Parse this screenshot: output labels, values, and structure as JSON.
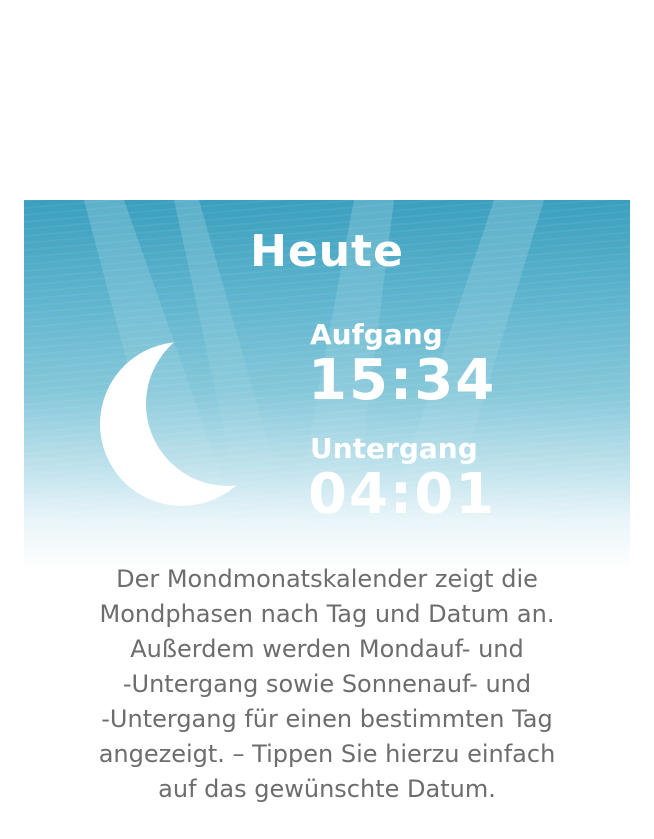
{
  "colors": {
    "sky_top": "#3a9fbe",
    "sky_bottom": "#ffffff",
    "foreground": "#ffffff",
    "description_text": "#6d6d6d"
  },
  "moon_card": {
    "title": "Heute",
    "moon_icon": "crescent-moon-icon",
    "rise_label": "Aufgang",
    "rise_time": "15:34",
    "set_label": "Untergang",
    "set_time": "04:01"
  },
  "description": {
    "lines": [
      "Der Mondmonatskalender zeigt die",
      "Mondphasen nach Tag und Datum an.",
      "Außerdem werden Mondauf- und",
      "-Untergang sowie Sonnenauf- und",
      "-Untergang für einen bestimmten Tag",
      "angezeigt. – Tippen Sie hierzu einfach",
      "auf das gewünschte Datum."
    ]
  }
}
